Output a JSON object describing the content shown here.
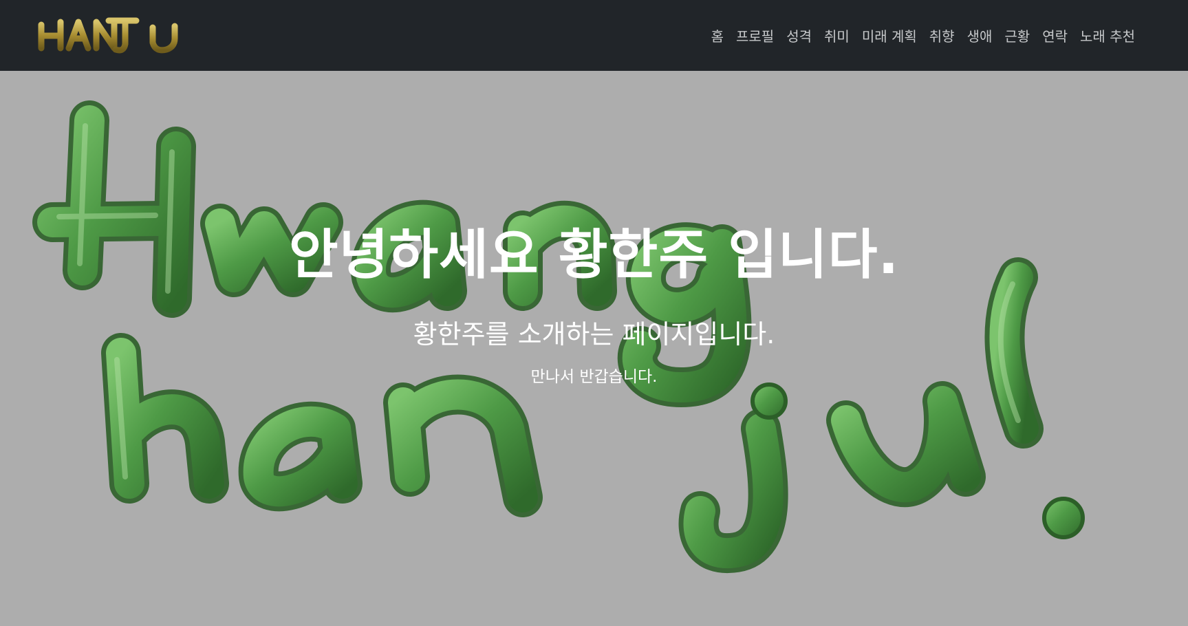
{
  "navbar": {
    "logo_text": "HANJU",
    "links": [
      {
        "label": "홈"
      },
      {
        "label": "프로필"
      },
      {
        "label": "성격"
      },
      {
        "label": "취미"
      },
      {
        "label": "미래 계획"
      },
      {
        "label": "취향"
      },
      {
        "label": "생애"
      },
      {
        "label": "근황"
      },
      {
        "label": "연락"
      },
      {
        "label": "노래 추천"
      }
    ]
  },
  "hero": {
    "background_art_text": "Hwang han ju!",
    "title": "안녕하세요 황한주 입니다.",
    "subtitle": "황한주를 소개하는 페이지입니다.",
    "note": "만나서 반갑습니다."
  },
  "colors": {
    "navbar_bg": "#212529",
    "nav_link": "#c7c9cb",
    "hero_bg": "#adadad",
    "art_green": "#4e9a46",
    "logo_gold": "#b39a3c",
    "hero_text": "#ffffff"
  }
}
